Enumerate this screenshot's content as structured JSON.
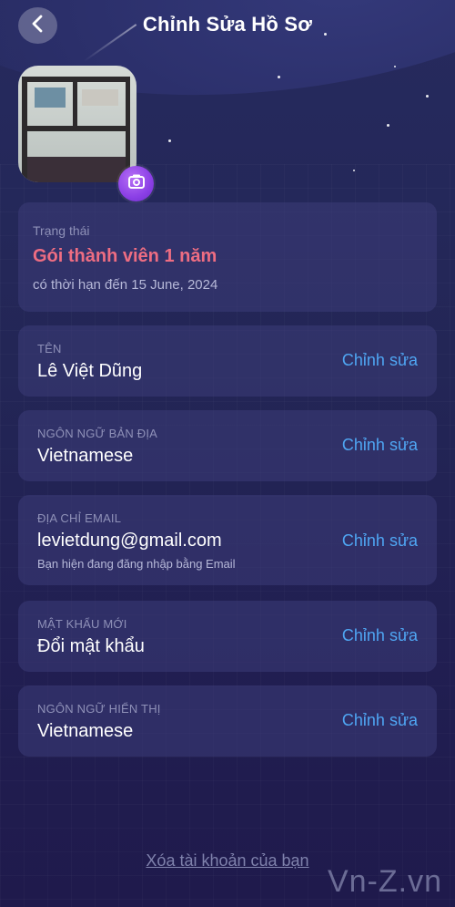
{
  "header": {
    "title": "Chỉnh Sửa Hồ Sơ",
    "back_icon": "chevron-left-icon"
  },
  "profile": {
    "avatar_icon": "camera-icon"
  },
  "status": {
    "label": "Trạng thái",
    "plan": "Gói thành viên 1 năm",
    "expiry": "có thời hạn đến 15 June, 2024"
  },
  "fields": [
    {
      "label": "TÊN",
      "value": "Lê Việt Dũng",
      "sub": "",
      "edit": "Chỉnh sửa"
    },
    {
      "label": "NGÔN NGỮ BẢN ĐỊA",
      "value": "Vietnamese",
      "sub": "",
      "edit": "Chỉnh sửa"
    },
    {
      "label": "ĐỊA CHỈ EMAIL",
      "value": "levietdung@gmail.com",
      "sub": "Bạn hiện đang đăng nhập bằng Email",
      "edit": "Chỉnh sửa"
    },
    {
      "label": "MẬT KHẨU MỚI",
      "value": "Đổi mật khẩu",
      "sub": "",
      "edit": "Chỉnh sửa"
    },
    {
      "label": "NGÔN NGỮ HIỂN THỊ",
      "value": "Vietnamese",
      "sub": "",
      "edit": "Chỉnh sửa"
    }
  ],
  "footer": {
    "delete_account": "Xóa tài khoản của bạn"
  },
  "watermark": "Vn-Z.vn",
  "colors": {
    "accent_link": "#4fa6f3",
    "plan_pink": "#ee6d82",
    "badge_purple": "#8b3fe6"
  }
}
